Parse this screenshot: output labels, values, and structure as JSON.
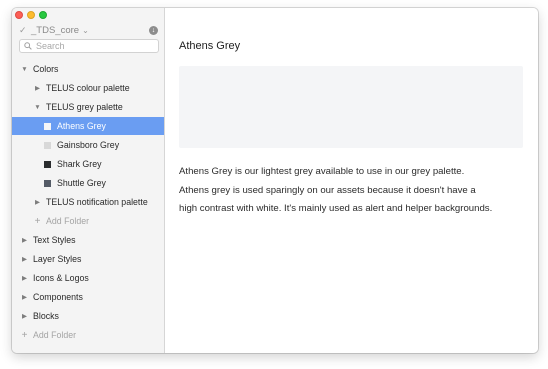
{
  "window": {
    "traffic_lights": [
      "close",
      "minimize",
      "maximize"
    ]
  },
  "library": {
    "name": "_TDS_core",
    "check_icon": "check-icon",
    "dropdown_icon": "chevron-down-icon",
    "sync_icon": "download-icon"
  },
  "search": {
    "placeholder": "Search",
    "value": ""
  },
  "tree": {
    "colors": {
      "label": "Colors",
      "expanded": true
    },
    "telus_colour_palette": {
      "label": "TELUS colour palette",
      "expanded": false
    },
    "telus_grey_palette": {
      "label": "TELUS grey palette",
      "expanded": true
    },
    "greys": [
      {
        "label": "Athens Grey",
        "swatch": "#f4f5f7",
        "selected": true
      },
      {
        "label": "Gainsboro Grey",
        "swatch": "#d8d8d8",
        "selected": false
      },
      {
        "label": "Shark Grey",
        "swatch": "#2a2c2e",
        "selected": false
      },
      {
        "label": "Shuttle Grey",
        "swatch": "#545b66",
        "selected": false
      }
    ],
    "telus_notification_palette": {
      "label": "TELUS notification palette",
      "expanded": false
    },
    "add_folder_nested": "Add Folder",
    "text_styles": {
      "label": "Text Styles"
    },
    "layer_styles": {
      "label": "Layer Styles"
    },
    "icons_logos": {
      "label": "Icons & Logos"
    },
    "components": {
      "label": "Components"
    },
    "blocks": {
      "label": "Blocks"
    },
    "add_folder_root": "Add Folder"
  },
  "detail": {
    "title": "Athens Grey",
    "preview_color": "#f4f5f7",
    "description_lines": [
      "Athens Grey is our lightest grey available to use in our grey palette.",
      "Athens grey is used sparingly on our assets because it doesn't have a",
      "high contrast with white. It's mainly used as alert and helper backgrounds."
    ]
  },
  "colors": {
    "selection": "#6a9df2",
    "sidebar_bg": "#f4f4f4"
  }
}
